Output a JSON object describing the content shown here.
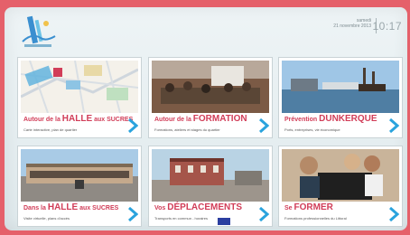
{
  "header": {
    "date_day": "samedi",
    "date_full": "21 novembre 2013",
    "time": "10:17"
  },
  "tiles": [
    {
      "title_pre": "Autour de la ",
      "title_big": "HALLE",
      "title_post": " aux SUCRES",
      "subtitle": "Carte interactive, plan de quartier",
      "image": "street-map"
    },
    {
      "title_pre": "Autour de la ",
      "title_big": "FORMATION",
      "title_post": "",
      "subtitle": "Formations, ateliers et stages du quartier",
      "image": "meeting-photo"
    },
    {
      "title_pre": "Prévention ",
      "title_big": "DUNKERQUE",
      "title_post": "",
      "subtitle": "Ports, entreprises, vie économique",
      "image": "harbor-photo"
    },
    {
      "title_pre": "Dans la ",
      "title_big": "HALLE",
      "title_post": " aux SUCRES",
      "subtitle": "Visite virtuelle, plans d'accès",
      "image": "building-photo"
    },
    {
      "title_pre": "Vos ",
      "title_big": "DÉPLACEMENTS",
      "title_post": "",
      "subtitle": "Transports en commun - horaires",
      "image": "station-photo"
    },
    {
      "title_pre": "Se ",
      "title_big": "FORMER",
      "title_post": "",
      "subtitle": "Formations professionnelles du Littoral",
      "image": "computer-photo"
    }
  ]
}
